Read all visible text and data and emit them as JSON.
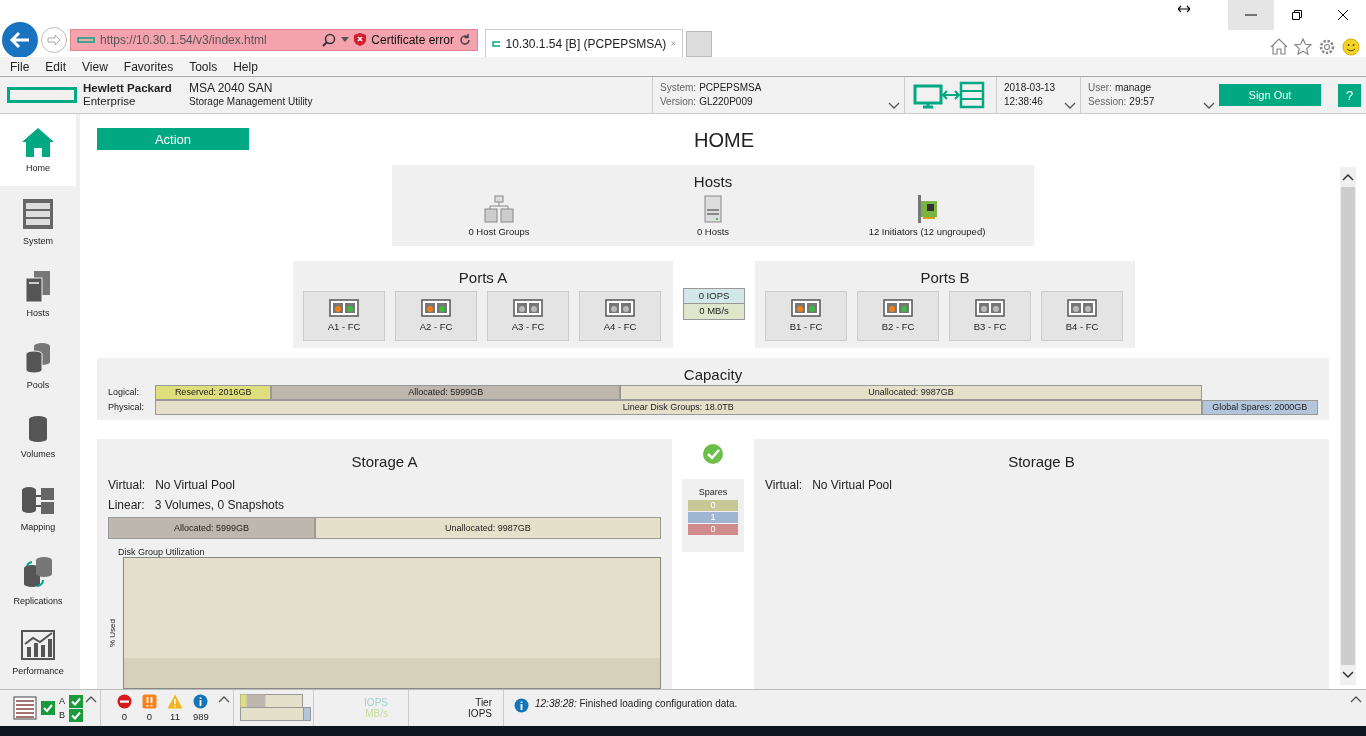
{
  "browser": {
    "address": "https://10.30.1.54/v3/index.html",
    "certificate_error": "Certificate error",
    "tab_title": "10.30.1.54 [B] (PCPEPSMSA)"
  },
  "menu": [
    "File",
    "Edit",
    "View",
    "Favorites",
    "Tools",
    "Help"
  ],
  "header": {
    "brand_line1": "Hewlett Packard",
    "brand_line2": "Enterprise",
    "product": "MSA 2040 SAN",
    "subtitle": "Storage Management Utility",
    "system_label": "System:",
    "system_value": "PCPEPSMSA",
    "version_label": "Version:",
    "version_value": "GL220P009",
    "date": "2018-03-13",
    "time": "12:38:46",
    "user_label": "User:",
    "user_value": "manage",
    "session_label": "Session:",
    "session_value": "29:57",
    "sign_out": "Sign Out",
    "help": "?"
  },
  "sidebar": {
    "items": [
      {
        "kind": "home",
        "label": "Home",
        "selected": true
      },
      {
        "kind": "system",
        "label": "System",
        "selected": false
      },
      {
        "kind": "hosts",
        "label": "Hosts",
        "selected": false
      },
      {
        "kind": "pools",
        "label": "Pools",
        "selected": false
      },
      {
        "kind": "volumes",
        "label": "Volumes",
        "selected": false
      },
      {
        "kind": "mapping",
        "label": "Mapping",
        "selected": false
      },
      {
        "kind": "replications",
        "label": "Replications",
        "selected": false
      },
      {
        "kind": "performance",
        "label": "Performance",
        "selected": false
      }
    ]
  },
  "action": "Action",
  "title": "HOME",
  "hosts": {
    "title": "Hosts",
    "items": [
      {
        "kind": "groups",
        "label": "0 Host Groups"
      },
      {
        "kind": "host",
        "label": "0 Hosts"
      },
      {
        "kind": "initiator",
        "label": "12 Initiators (12 ungrouped)"
      }
    ]
  },
  "port_groups": [
    {
      "title": "Ports A",
      "ports": [
        {
          "label": "A1 - FC",
          "connected": true
        },
        {
          "label": "A2 - FC",
          "connected": true
        },
        {
          "label": "A3 - FC",
          "connected": false
        },
        {
          "label": "A4 - FC",
          "connected": false
        }
      ]
    },
    {
      "title": "Ports B",
      "ports": [
        {
          "label": "B1 - FC",
          "connected": true
        },
        {
          "label": "B2 - FC",
          "connected": true
        },
        {
          "label": "B3 - FC",
          "connected": false
        },
        {
          "label": "B4 - FC",
          "connected": false
        }
      ]
    }
  ],
  "throughput": {
    "iops": "0 IOPS",
    "mbs": "0 MB/s"
  },
  "capacity": {
    "title": "Capacity",
    "logical_label": "Logical:",
    "physical_label": "Physical:",
    "logical": [
      {
        "kind": "reserved",
        "label": "Reserved: 2016GB"
      },
      {
        "kind": "allocated",
        "label": "Allocated: 5999GB"
      },
      {
        "kind": "unallocated",
        "label": "Unallocated: 9987GB"
      }
    ],
    "physical": [
      {
        "kind": "unallocated",
        "label": "Linear Disk Groups: 18.0TB"
      },
      {
        "kind": "spares",
        "label": "Global Spares: 2000GB"
      }
    ]
  },
  "storage_a": {
    "title": "Storage A",
    "rows": [
      {
        "label": "Virtual:",
        "value": "No Virtual Pool"
      },
      {
        "label": "Linear:",
        "value": "3 Volumes, 0 Snapshots"
      }
    ],
    "bar": [
      {
        "kind": "allocated",
        "label": "Allocated: 5999GB"
      },
      {
        "kind": "unallocated",
        "label": "Unallocated: 9987GB"
      }
    ],
    "chart_title": "Disk Group Utilization",
    "y_label": "% Used"
  },
  "spares": {
    "title": "Spares",
    "values": [
      {
        "value": "0",
        "color": "#c8c896"
      },
      {
        "value": "1",
        "color": "#9fb6d2"
      },
      {
        "value": "0",
        "color": "#d08c8c"
      }
    ]
  },
  "storage_b": {
    "title": "Storage B",
    "rows": [
      {
        "label": "Virtual:",
        "value": "No Virtual Pool"
      }
    ]
  },
  "status_bar": {
    "controllers": [
      {
        "label": "A",
        "ok": true
      },
      {
        "label": "B",
        "ok": true
      }
    ],
    "alerts": [
      {
        "kind": "critical",
        "count": "0"
      },
      {
        "kind": "error",
        "count": "0"
      },
      {
        "kind": "warning",
        "count": "11"
      },
      {
        "kind": "info",
        "count": "989"
      }
    ],
    "iops_label": "IOPS",
    "mbs_label": "MB/s",
    "tier_label": "Tier",
    "tier_iops_label": "IOPS",
    "message": "*12:38:28:* Finished loading configuration data."
  }
}
